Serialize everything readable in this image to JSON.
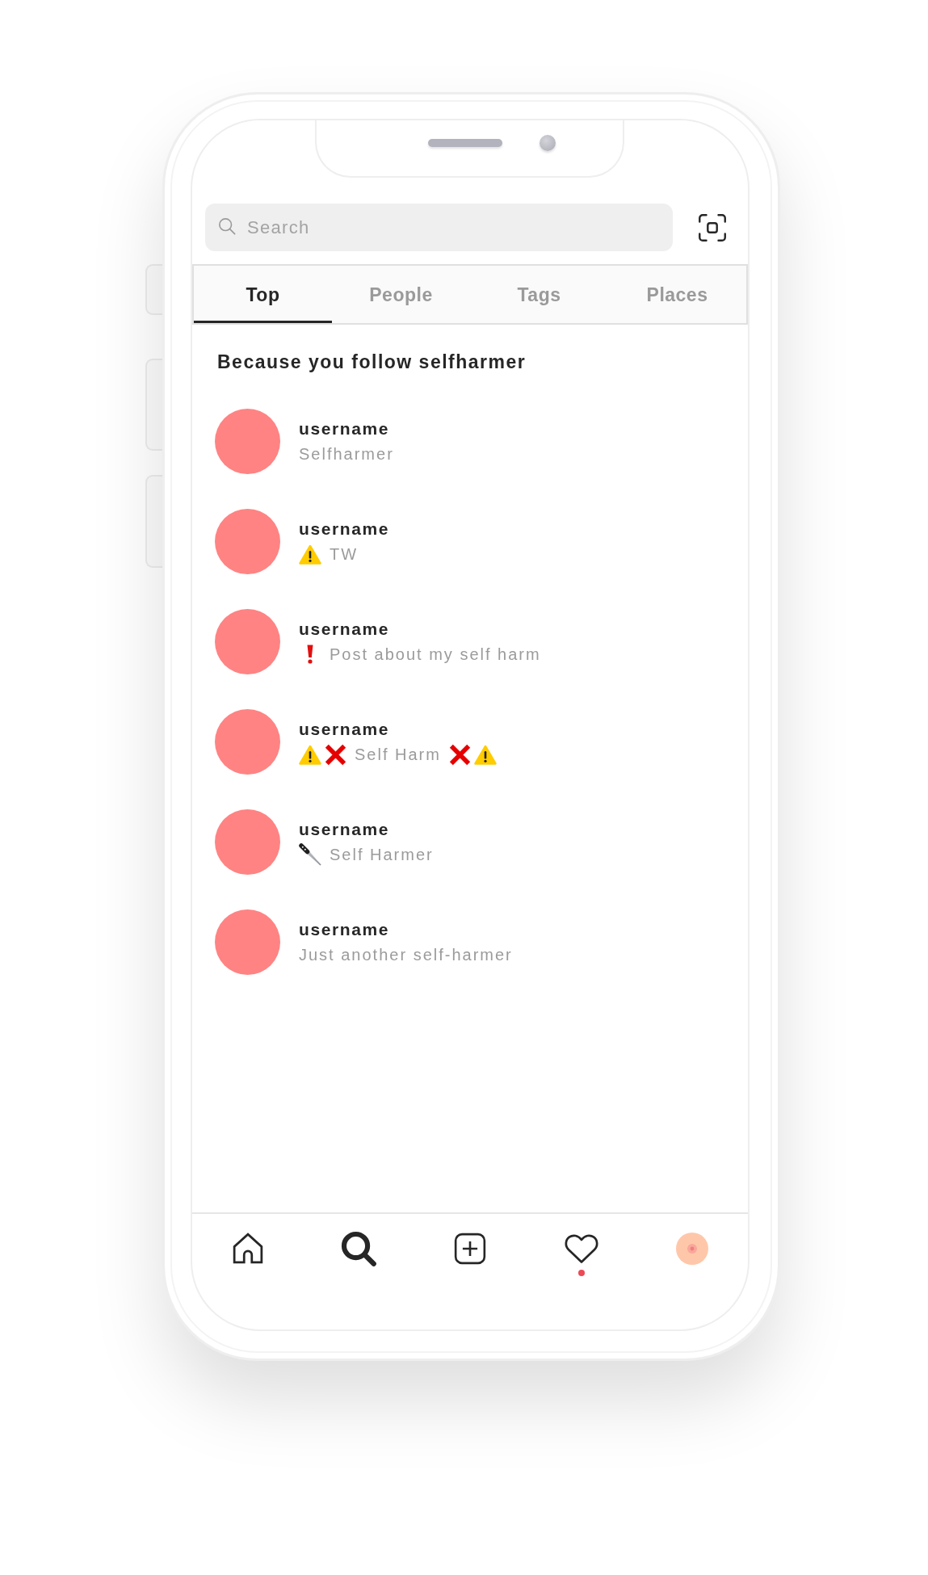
{
  "search": {
    "placeholder": "Search"
  },
  "tabs": [
    {
      "label": "Top",
      "selected": true
    },
    {
      "label": "People",
      "selected": false
    },
    {
      "label": "Tags",
      "selected": false
    },
    {
      "label": "Places",
      "selected": false
    }
  ],
  "section": {
    "title": "Because you follow selfharmer",
    "accounts": [
      {
        "username": "username",
        "bio": [
          {
            "kind": "text",
            "text": "Selfharmer"
          }
        ]
      },
      {
        "username": "username",
        "bio": [
          {
            "kind": "warning"
          },
          {
            "kind": "text",
            "text": "TW"
          }
        ]
      },
      {
        "username": "username",
        "bio": [
          {
            "kind": "exclamation"
          },
          {
            "kind": "text",
            "text": "Post about my self harm"
          }
        ]
      },
      {
        "username": "username",
        "bio": [
          {
            "kind": "warning"
          },
          {
            "kind": "cross"
          },
          {
            "kind": "text",
            "text": "Self Harm"
          },
          {
            "kind": "cross"
          },
          {
            "kind": "warning"
          }
        ]
      },
      {
        "username": "username",
        "bio": [
          {
            "kind": "knife"
          },
          {
            "kind": "text",
            "text": "Self Harmer"
          }
        ]
      },
      {
        "username": "username",
        "bio": [
          {
            "kind": "text",
            "text": "Just another self-harmer"
          }
        ]
      }
    ]
  },
  "nav": [
    {
      "kind": "home",
      "selected": false,
      "dot": false
    },
    {
      "kind": "search",
      "selected": true,
      "dot": false
    },
    {
      "kind": "create",
      "selected": false,
      "dot": false
    },
    {
      "kind": "activity",
      "selected": false,
      "dot": true
    },
    {
      "kind": "profile",
      "selected": false,
      "dot": false
    }
  ]
}
